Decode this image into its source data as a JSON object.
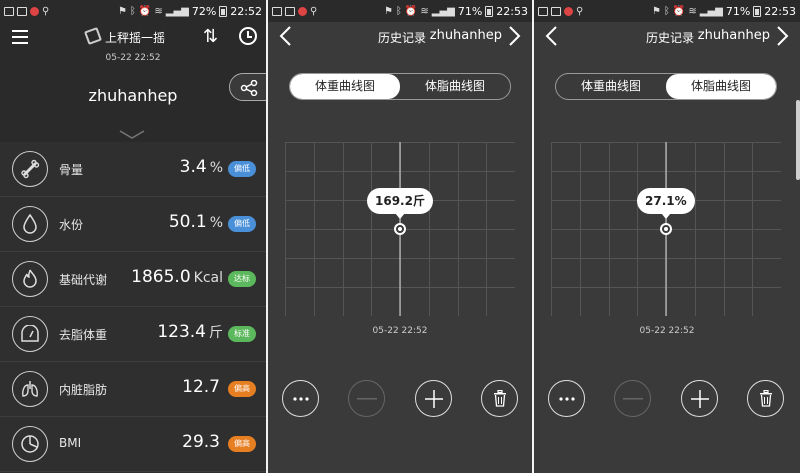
{
  "status": {
    "left_icons": [
      "gallery-icon",
      "app-icon",
      "notification-icon",
      "antenna-icon"
    ],
    "battery": "72%",
    "time": "22:52",
    "battery_p2": "71%",
    "time_p2": "22:53",
    "battery_p3": "71%",
    "time_p3": "22:53"
  },
  "home": {
    "app_title": "上秤摇一摇",
    "measure_time": "05-22 22:52",
    "username": "zhuhanhep",
    "metrics": [
      {
        "icon": "bone-icon",
        "label": "骨量",
        "value": "3.4",
        "unit": "%",
        "badge": "偏低",
        "badge_color": "#4a90d9"
      },
      {
        "icon": "water-drop-icon",
        "label": "水份",
        "value": "50.1",
        "unit": "%",
        "badge": "偏低",
        "badge_color": "#4a90d9"
      },
      {
        "icon": "flame-icon",
        "label": "基础代谢",
        "value": "1865.0",
        "unit": "Kcal",
        "badge": "达标",
        "badge_color": "#5cb85c"
      },
      {
        "icon": "scale-icon",
        "label": "去脂体重",
        "value": "123.4",
        "unit": "斤",
        "badge": "标准",
        "badge_color": "#5cb85c"
      },
      {
        "icon": "lungs-icon",
        "label": "内脏脂肪",
        "value": "12.7",
        "unit": "",
        "badge": "偏高",
        "badge_color": "#e67e22"
      },
      {
        "icon": "pie-chart-icon",
        "label": "BMI",
        "value": "29.3",
        "unit": "",
        "badge": "偏高",
        "badge_color": "#e67e22"
      }
    ]
  },
  "history": {
    "title": "历史记录",
    "username": "zhuhanhep",
    "tab_weight": "体重曲线图",
    "tab_fat": "体脂曲线图",
    "date": "05-22 22:52"
  },
  "weight_chart": {
    "active_tab": "weight",
    "tooltip": "169.2斤",
    "chart_data": {
      "type": "line",
      "x": [
        "05-22 22:52"
      ],
      "series": [
        {
          "values": [
            169.2
          ]
        }
      ],
      "xlabel": "",
      "ylabel": ""
    }
  },
  "fat_chart": {
    "active_tab": "fat",
    "tooltip": "27.1%",
    "chart_data": {
      "type": "line",
      "x": [
        "05-22 22:52"
      ],
      "series": [
        {
          "values": [
            27.1
          ]
        }
      ],
      "xlabel": "",
      "ylabel": ""
    }
  }
}
